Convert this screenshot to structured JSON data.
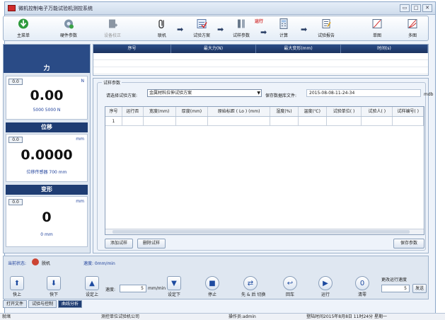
{
  "window": {
    "title": "微机控制电子万能试验机测控系统",
    "controls": [
      "▭",
      "□",
      "✕"
    ]
  },
  "toolbar": {
    "main_menu": "主菜单",
    "hardware_params": "硬件参数",
    "device_calibration": "设备校正",
    "connect": "联机",
    "test_plan": "试验方案",
    "test_params": "试样参数",
    "run_badge": "运行",
    "calculate": "计算",
    "test_report": "试验报告",
    "single_chart": "单图",
    "multi_chart": "多图"
  },
  "sidebar": {
    "force": {
      "title": "力",
      "zero": "0.0",
      "unit": "N",
      "value": "0.00",
      "sub": "5000  5000  N"
    },
    "displacement": {
      "title": "位移",
      "zero": "0.0",
      "unit": "mm",
      "value": "0.0000",
      "sub": "位移传感器  700  mm"
    },
    "deformation": {
      "title": "变形",
      "zero": "0.0",
      "unit": "mm",
      "value": "0",
      "sub": "0  mm"
    }
  },
  "top_grid": {
    "columns": [
      "序号",
      "最大力(N)",
      "最大变形(mm)",
      "时间(s)"
    ]
  },
  "specimen": {
    "group_title": "试样参数",
    "plan_label": "请选择试验方案:",
    "plan_value": "金属材料拉伸试验方案",
    "file_label": "保存数据库文件:",
    "file_value": "2015-08-08-11-24-34",
    "file_ext": "mdb",
    "columns": [
      "序号",
      "运行否",
      "宽度(mm)",
      "厚度(mm)",
      "原始标距 ( Lo ) (mm)",
      "湿度(%)",
      "温度(℃)",
      "试验单位(  )",
      "试验人(  )",
      "试样编号(  )"
    ],
    "rows": [
      [
        "1",
        "",
        "",
        "",
        "",
        "",
        "",
        "",
        "",
        ""
      ]
    ],
    "add_button": "添加试样",
    "delete_button": "删除试样",
    "save_button": "保存参数"
  },
  "control": {
    "status_label": "当前状态:",
    "status_value": "脱机",
    "speed_label": "速度: 0mm/min",
    "fast_up": "快上",
    "fast_down": "快下",
    "set_up": "设定上",
    "speed_input_label": "速度:",
    "speed_value": "5",
    "speed_unit": "mm/min",
    "set_down": "设定下",
    "stop": "停止",
    "sensor_switch": "先 & 后 切换",
    "return": "回车",
    "run": "运行",
    "clear": "清零",
    "change_speed_label": "更改运行速度",
    "change_speed_value": "5",
    "send": "发送"
  },
  "tabs": [
    "打开文件",
    "试验与控制",
    "曲线分析"
  ],
  "statusbar": {
    "left": "就绪",
    "company": "测控单位试验机公司",
    "operator": "操作员:admin",
    "datetime": "登陆时间2015年8月8日  11时24分  星期一"
  }
}
